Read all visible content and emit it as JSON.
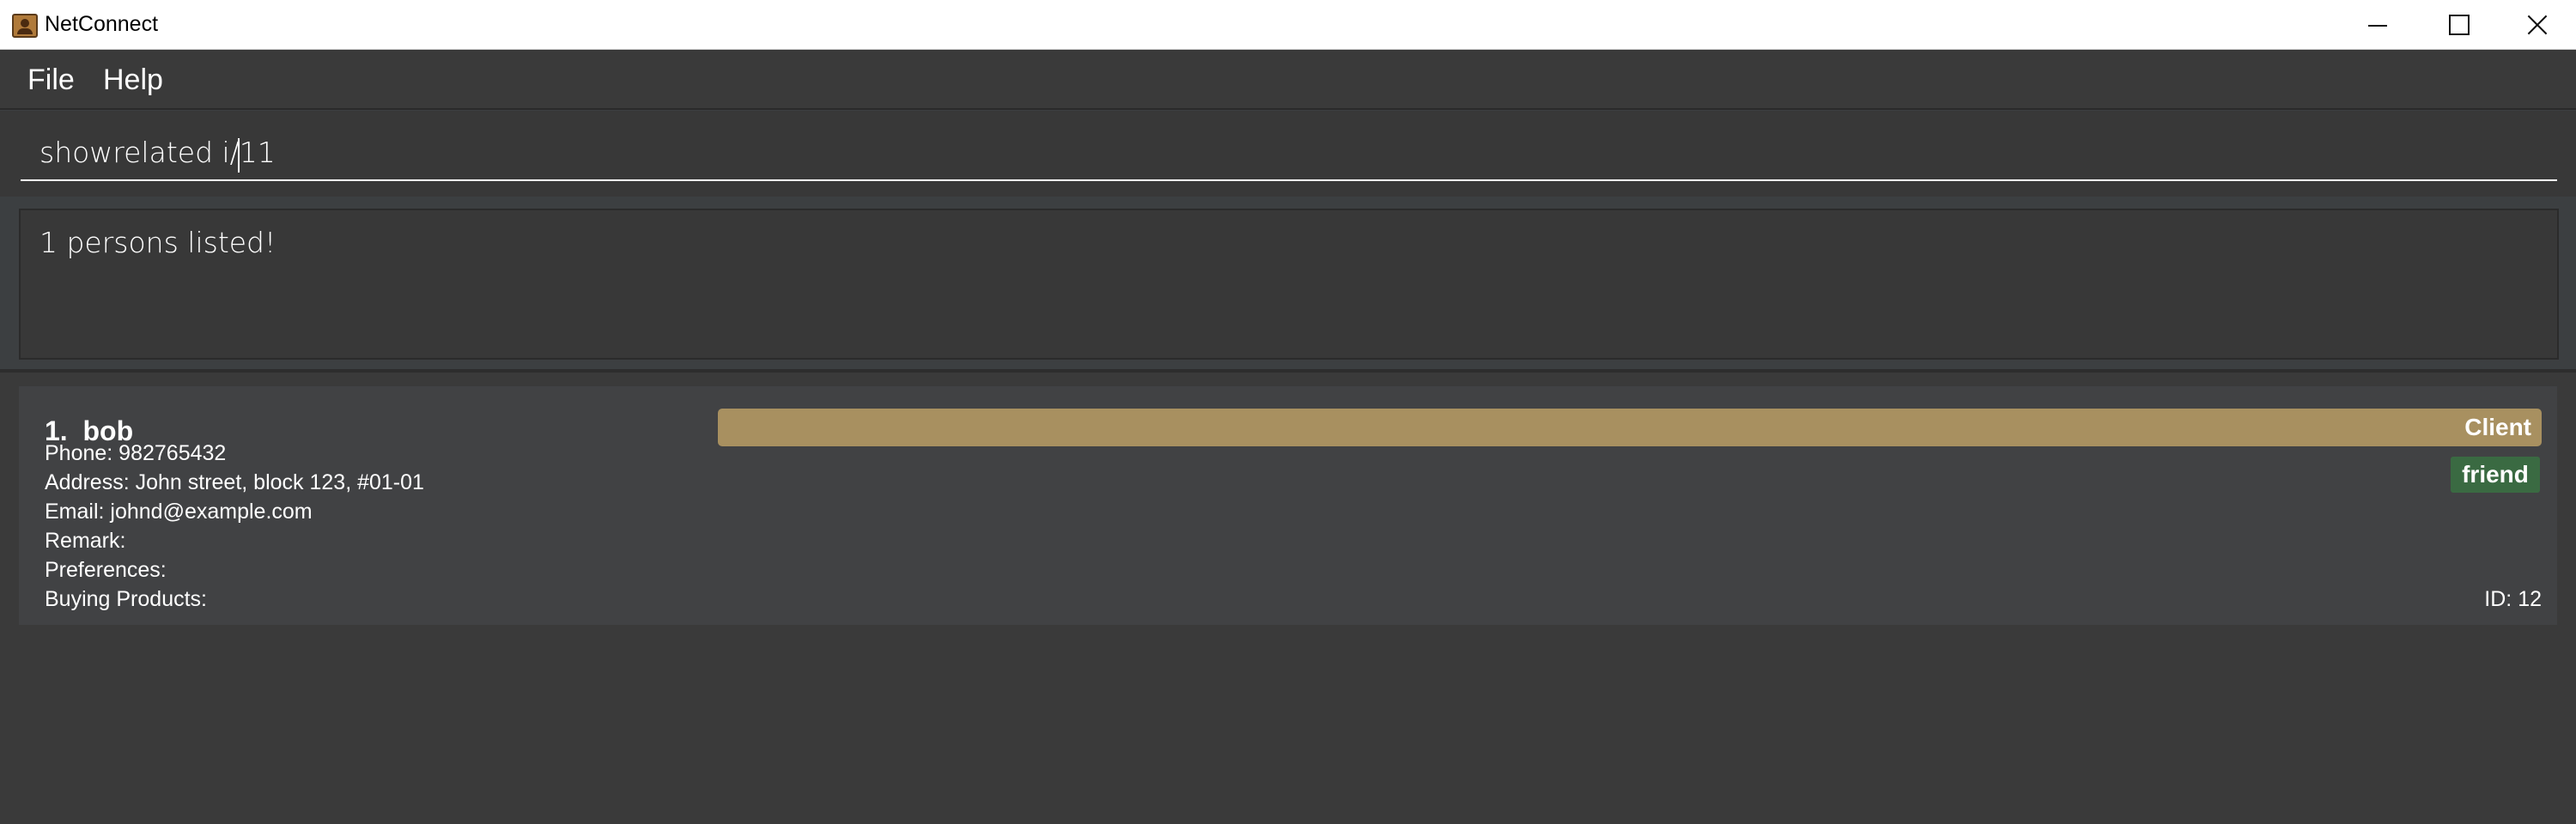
{
  "window": {
    "title": "NetConnect",
    "icon": "contact-book-icon"
  },
  "menu": {
    "items": [
      {
        "label": "File"
      },
      {
        "label": "Help"
      }
    ]
  },
  "command_box": {
    "value": "showrelated i/11"
  },
  "result": {
    "message": "1 persons listed!"
  },
  "person": {
    "index_name": "1.  bob",
    "phone": "Phone: 982765432",
    "address": "Address: John street, block 123, #01-01",
    "email": "Email: johnd@example.com",
    "remark": "Remark:",
    "preferences": "Preferences:",
    "buying": "Buying Products:",
    "role_label": "Client",
    "tag": "friend",
    "id_text": "ID: 12"
  },
  "colors": {
    "client_bar": "#a89060",
    "friend_tag": "#3a6a42",
    "background": "#3c3f41",
    "card": "#414244"
  }
}
